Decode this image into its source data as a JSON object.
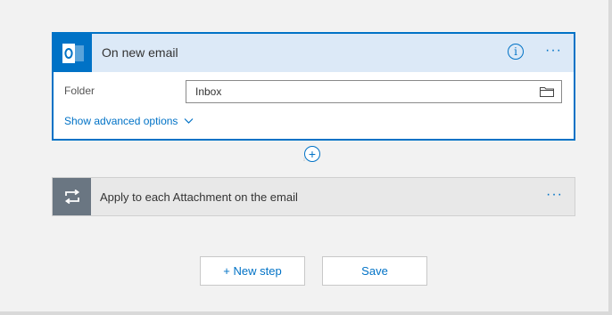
{
  "trigger": {
    "title": "On new email",
    "icon": "outlook-icon",
    "info_label": "i",
    "more_label": "···",
    "folder_label": "Folder",
    "folder_value": "Inbox",
    "advanced_label": "Show advanced options"
  },
  "connector": {
    "add_label": "+"
  },
  "action": {
    "title": "Apply to each Attachment on the email",
    "icon": "loop-icon",
    "more_label": "···"
  },
  "buttons": {
    "new_step": "+ New step",
    "save": "Save"
  },
  "colors": {
    "accent": "#0072c6",
    "header_bg": "#dce9f7",
    "loop_icon_bg": "#6a7682",
    "action_bg": "#e8e8e8",
    "page_bg": "#f2f2f2"
  }
}
